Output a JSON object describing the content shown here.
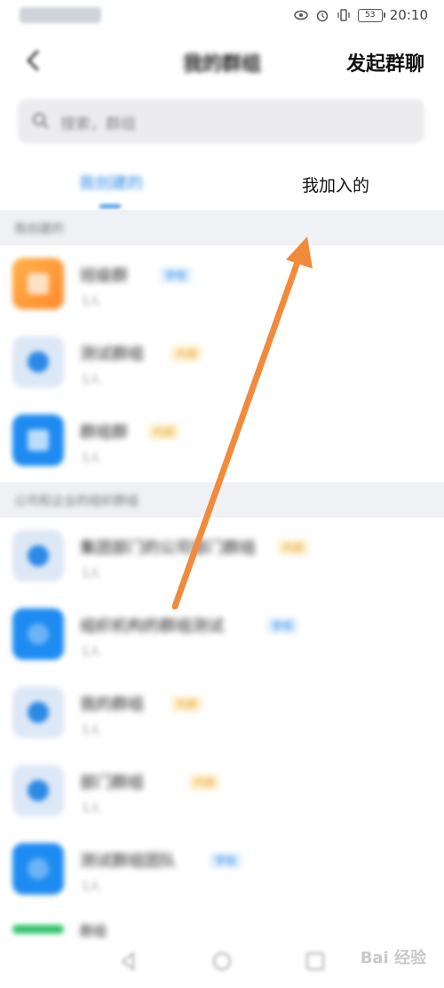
{
  "status_bar": {
    "time": "20:10",
    "battery_level": "53"
  },
  "header": {
    "title": "我的群组",
    "start_chat_label": "发起群聊"
  },
  "search": {
    "placeholder": "搜索，群组"
  },
  "tabs": {
    "created_label": "我创建的",
    "joined_label": "我加入的"
  },
  "sections": [
    {
      "label": "我创建的"
    },
    {
      "label": "公司和企业的组织群组"
    }
  ],
  "groups": [
    {
      "name": "班级群",
      "badge": "学校",
      "count": "1人",
      "avatar": "orange"
    },
    {
      "name": "测试群组",
      "badge": "内部",
      "count": "1人",
      "avatar": "light"
    },
    {
      "name": "群组群",
      "badge": "内部",
      "count": "1人",
      "avatar": "blue"
    },
    {
      "name": "集团部门的公司部门群组",
      "badge": "内部",
      "count": "1人",
      "avatar": "light"
    },
    {
      "name": "组织机构的群组测试",
      "badge": "学校",
      "count": "1人",
      "avatar": "blue"
    },
    {
      "name": "我的群组",
      "badge": "内部",
      "count": "1人",
      "avatar": "light"
    },
    {
      "name": "部门群组",
      "badge": "内部",
      "count": "1人",
      "avatar": "light"
    },
    {
      "name": "测试群组团队",
      "badge": "学校",
      "count": "1人",
      "avatar": "blue"
    },
    {
      "name": "群组",
      "badge": "",
      "count": "",
      "avatar": "green"
    }
  ],
  "colors": {
    "accent": "#2b8ae6",
    "arrow": "#f28a3c"
  },
  "watermark": "Bai 经验"
}
